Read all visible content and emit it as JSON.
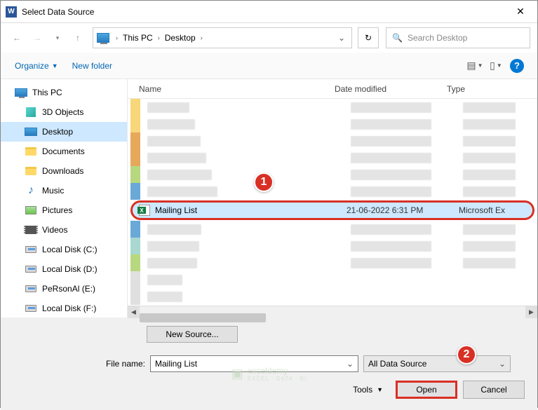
{
  "title": "Select Data Source",
  "breadcrumb": [
    "This PC",
    "Desktop"
  ],
  "search_placeholder": "Search Desktop",
  "toolbar": {
    "organize": "Organize",
    "new_folder": "New folder"
  },
  "tree": {
    "items": [
      {
        "label": "This PC",
        "icon": "monitor",
        "indent": false
      },
      {
        "label": "3D Objects",
        "icon": "cube3d",
        "indent": true
      },
      {
        "label": "Desktop",
        "icon": "desktop",
        "indent": true,
        "selected": true
      },
      {
        "label": "Documents",
        "icon": "folder",
        "indent": true
      },
      {
        "label": "Downloads",
        "icon": "folder",
        "indent": true
      },
      {
        "label": "Music",
        "icon": "music",
        "indent": true
      },
      {
        "label": "Pictures",
        "icon": "pic",
        "indent": true
      },
      {
        "label": "Videos",
        "icon": "vid",
        "indent": true
      },
      {
        "label": "Local Disk (C:)",
        "icon": "disk",
        "indent": true
      },
      {
        "label": "Local Disk (D:)",
        "icon": "disk",
        "indent": true
      },
      {
        "label": "PeRsonAl (E:)",
        "icon": "disk",
        "indent": true
      },
      {
        "label": "Local Disk (F:)",
        "icon": "disk",
        "indent": true
      }
    ]
  },
  "columns": {
    "name": "Name",
    "date": "Date modified",
    "type": "Type"
  },
  "selected_file": {
    "name": "Mailing List",
    "date": "21-06-2022 6:31 PM",
    "type": "Microsoft Ex"
  },
  "callouts": {
    "one": "1",
    "two": "2"
  },
  "footer": {
    "new_source": "New Source...",
    "filename_label": "File name:",
    "filename_value": "Mailing List",
    "filter": "All Data Source",
    "tools": "Tools",
    "open": "Open",
    "cancel": "Cancel"
  },
  "watermark": {
    "brand": "exceldemy",
    "tag": "EXCEL · DATA · BI"
  },
  "stripe_colors": [
    "#f7d77a",
    "#f7d77a",
    "#e6a85a",
    "#e6a85a",
    "#b8d880",
    "#6aa8d8",
    "#6aa8d8",
    "#a8d8d0",
    "#b8d880"
  ]
}
